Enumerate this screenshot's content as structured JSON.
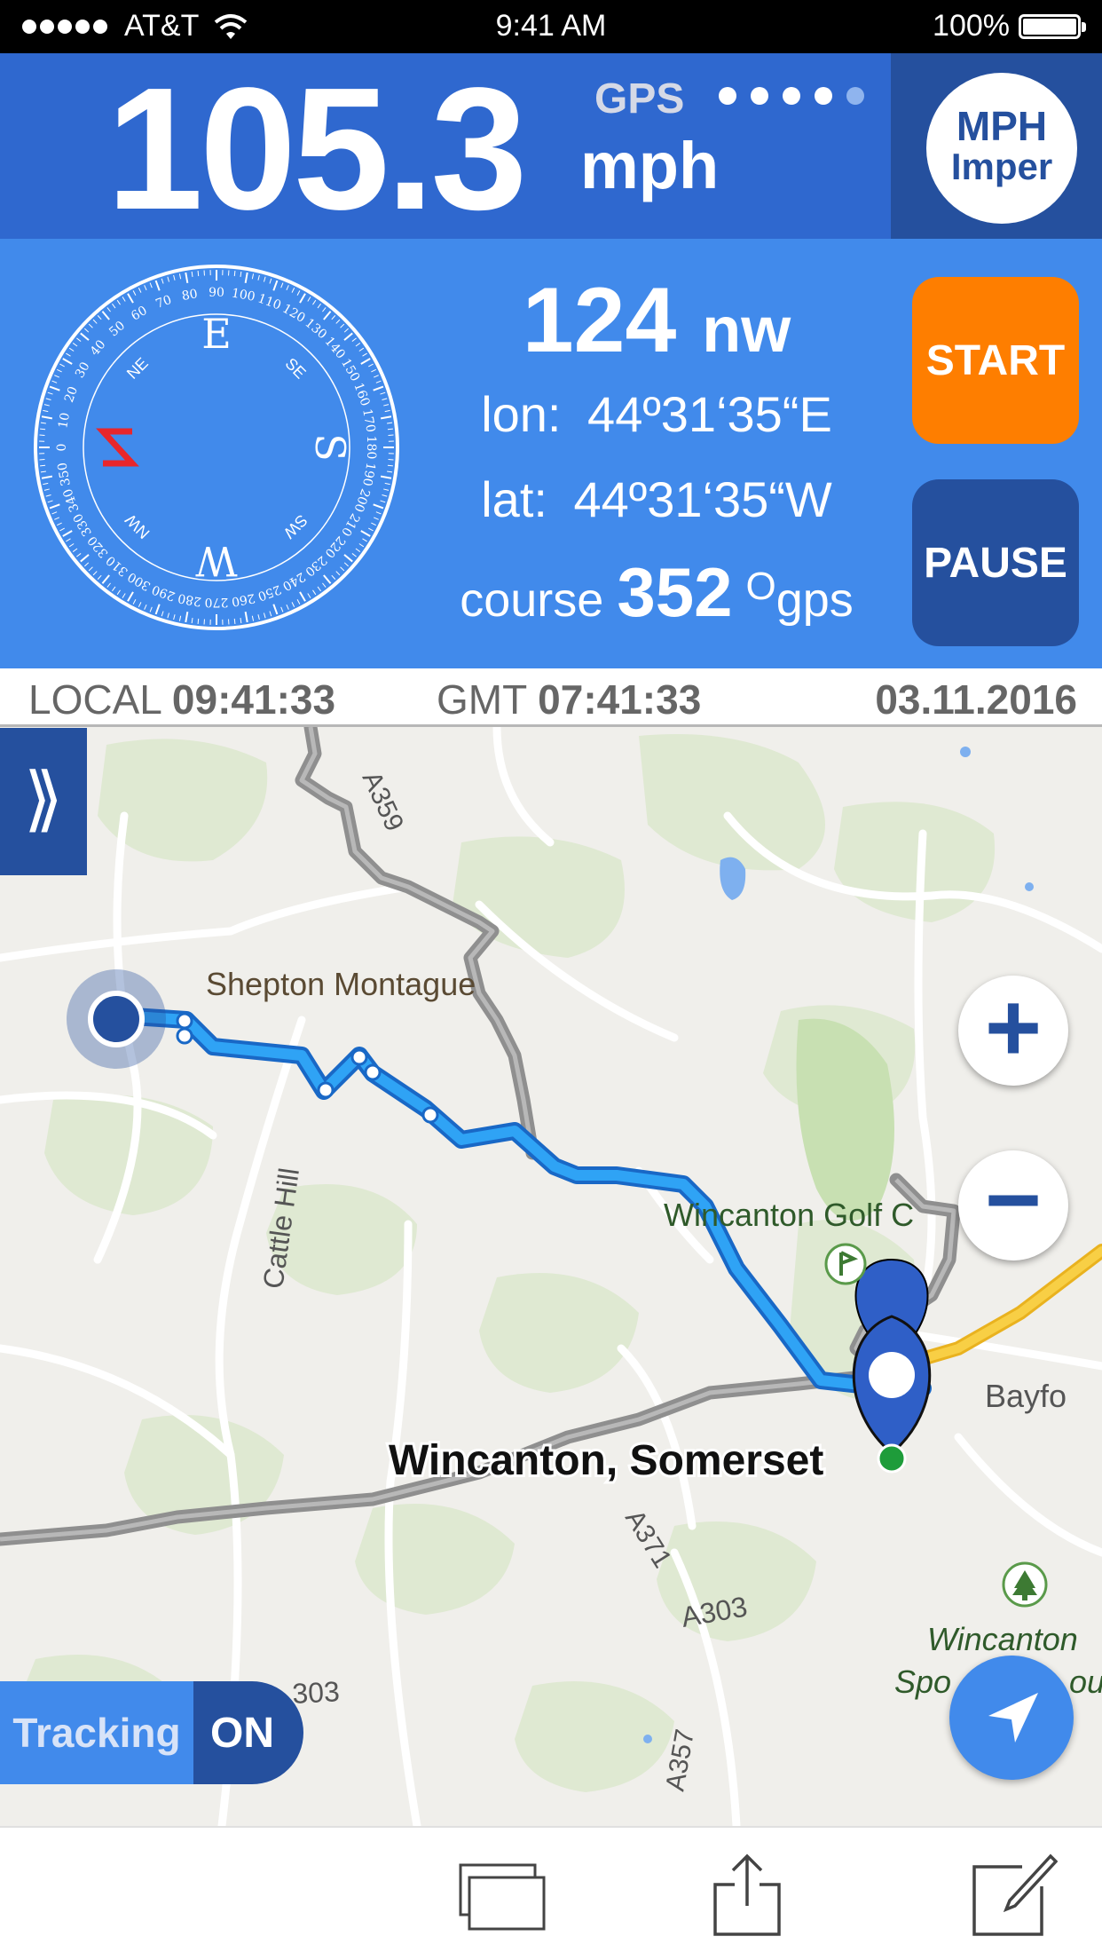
{
  "status_bar": {
    "carrier": "AT&T",
    "time": "9:41 AM",
    "battery": "100%",
    "battery_level": 1.0,
    "signal_icon": "signal-dots-icon",
    "wifi_icon": "wifi-icon"
  },
  "speed": {
    "value": "105.3",
    "unit": "mph",
    "source_label": "GPS",
    "gps_strength": {
      "filled": 4,
      "total": 5
    },
    "unit_button": {
      "line1": "MPH",
      "line2": "Imper"
    }
  },
  "compass": {
    "heading_value": "124",
    "heading_dir": "nw",
    "cardinals": {
      "n": "N",
      "e": "E",
      "s": "S",
      "w": "W"
    },
    "intercardinals": {
      "ne": "NE",
      "nw": "NW",
      "se": "SE",
      "sw": "SW"
    },
    "needle_color": "#e8262b"
  },
  "coords": {
    "lon_label": "lon:",
    "lon_value": "44º31‘35“E",
    "lat_label": "lat:",
    "lat_value": "44º31‘35“W",
    "course_label": "course",
    "course_value": "352",
    "course_unit": "gps",
    "degree_symbol": "O"
  },
  "buttons": {
    "start": "START",
    "pause": "PAUSE"
  },
  "time_bar": {
    "local_label": "LOCAL",
    "local_value": "09:41:33",
    "gmt_label": "GMT",
    "gmt_value": "07:41:33",
    "date": "03.11.2016"
  },
  "map": {
    "places": {
      "shepton": "Shepton Montague",
      "golf": "Wincanton Golf C",
      "wincanton": "Wincanton, Somerset",
      "bayford": "Bayfo",
      "sports1": "Wincanton",
      "sports2": "Spo",
      "sports3": "ou"
    },
    "roads": {
      "a359": "A359",
      "cattle_hill": "Cattle Hill",
      "a371": "A371",
      "a303": "A303",
      "a303b": "303",
      "a357": "A357"
    },
    "zoom_in": "+",
    "zoom_out": "−",
    "sidebar_toggle": "⟫",
    "tracking_label": "Tracking",
    "tracking_state": "ON",
    "colors": {
      "route": "#2a9bf2",
      "road_major": "#9e9e9e",
      "road_yellow": "#f8c52d",
      "water": "#7eb0ef",
      "park": "#d4e6c2"
    }
  },
  "toolbar": {
    "icons": [
      "windows-icon",
      "share-icon",
      "edit-icon"
    ]
  },
  "accent_colors": {
    "dark_blue": "#25509e",
    "mid_blue": "#2f68cf",
    "light_blue": "#418aeb",
    "orange": "#fe7e00"
  }
}
